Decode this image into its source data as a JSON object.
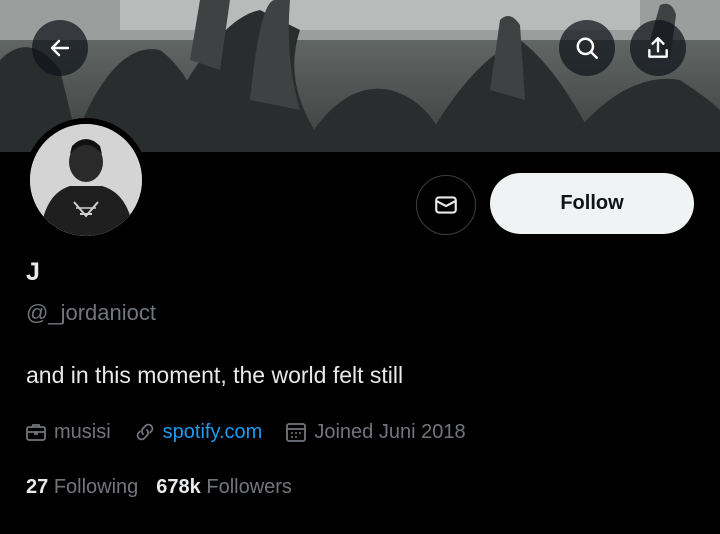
{
  "header": {
    "back_icon": "arrow-left-icon",
    "search_icon": "search-icon",
    "share_icon": "share-icon"
  },
  "profile": {
    "name": "J",
    "handle": "@_jordanioct",
    "bio": "and in this moment, the world felt still",
    "follow_label": "Follow",
    "message_icon": "envelope-icon"
  },
  "meta": {
    "category": "musisi",
    "category_icon": "briefcase-icon",
    "link": "spotify.com",
    "link_icon": "link-icon",
    "joined": "Joined Juni 2018",
    "joined_icon": "calendar-icon"
  },
  "stats": {
    "following_count": "27",
    "following_label": "Following",
    "followers_count": "678k",
    "followers_label": "Followers"
  },
  "colors": {
    "background": "#000000",
    "link": "#1d9bf0",
    "muted": "#71767b",
    "text": "#e7e9ea",
    "follow_bg": "#eff3f4"
  }
}
